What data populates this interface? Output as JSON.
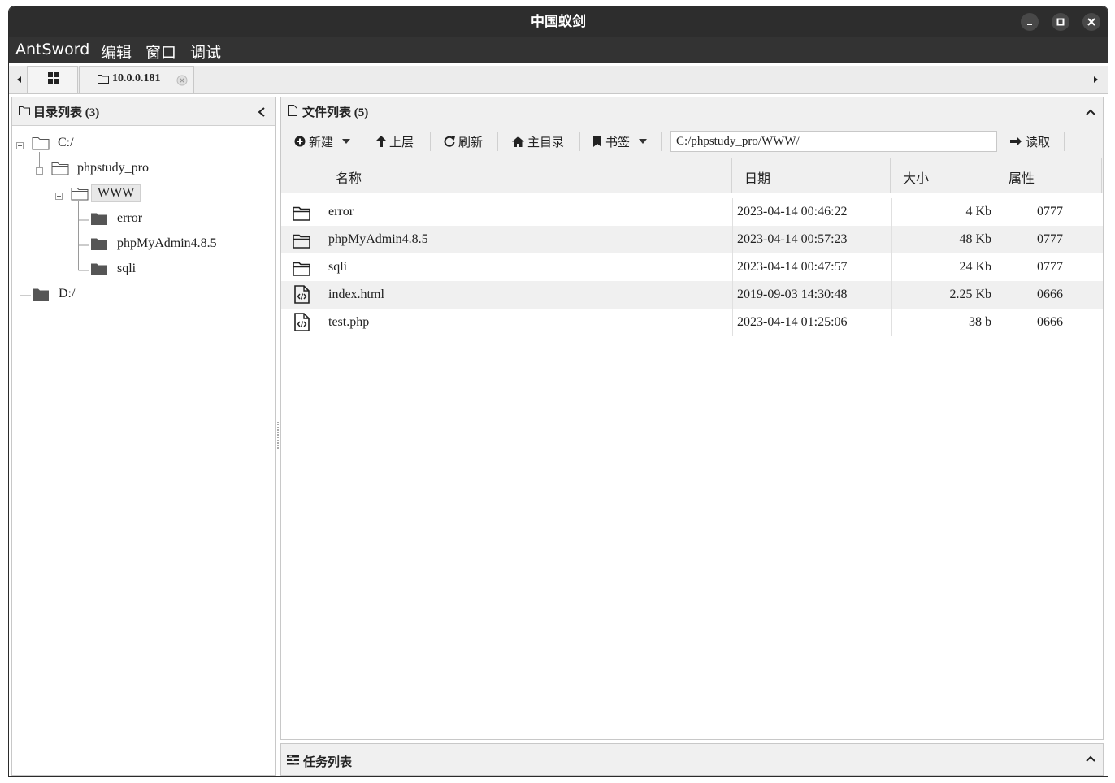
{
  "window": {
    "title": "中国蚁剑"
  },
  "menu": {
    "items": [
      "AntSword",
      "编辑",
      "窗口",
      "调试"
    ]
  },
  "tabs": {
    "active_label": "10.0.0.181"
  },
  "dir_panel": {
    "title": "目录列表 (3)",
    "tree": {
      "c_drive": "C:/",
      "phpstudy_pro": "phpstudy_pro",
      "www": "WWW",
      "error": "error",
      "phpmyadmin": "phpMyAdmin4.8.5",
      "sqli": "sqli",
      "d_drive": "D:/"
    }
  },
  "file_panel": {
    "title": "文件列表 (5)",
    "toolbar": {
      "new": "新建",
      "up": "上层",
      "refresh": "刷新",
      "home": "主目录",
      "bookmark": "书签",
      "path": "C:/phpstudy_pro/WWW/",
      "read": "读取"
    },
    "columns": {
      "name": "名称",
      "date": "日期",
      "size": "大小",
      "attr": "属性"
    },
    "rows": [
      {
        "name": "error",
        "date": "2023-04-14 00:46:22",
        "size": "4 Kb",
        "attr": "0777",
        "icon": "folder-icon"
      },
      {
        "name": "phpMyAdmin4.8.5",
        "date": "2023-04-14 00:57:23",
        "size": "48 Kb",
        "attr": "0777",
        "icon": "folder-icon"
      },
      {
        "name": "sqli",
        "date": "2023-04-14 00:47:57",
        "size": "24 Kb",
        "attr": "0777",
        "icon": "folder-icon"
      },
      {
        "name": "index.html",
        "date": "2019-09-03 14:30:48",
        "size": "2.25 Kb",
        "attr": "0666",
        "icon": "code-file-icon"
      },
      {
        "name": "test.php",
        "date": "2023-04-14 01:25:06",
        "size": "38 b",
        "attr": "0666",
        "icon": "code-file-icon"
      }
    ]
  },
  "task_panel": {
    "title": "任务列表"
  }
}
